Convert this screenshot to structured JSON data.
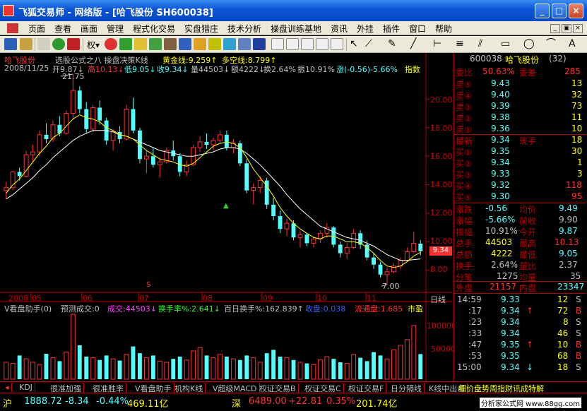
{
  "window": {
    "title": "飞狐交易师 - 网络版 - [哈飞股份 SH600038]",
    "min_glyph": "_",
    "max_glyph": "□",
    "close_glyph": "×"
  },
  "menu": {
    "items": [
      "页面",
      "查看",
      "画面",
      "管理",
      "程式化交易",
      "实盘猎庄",
      "技术分析",
      "操盘训练基地",
      "资讯",
      "外挂",
      "插件",
      "窗口",
      "帮助"
    ],
    "mdi_min": "_",
    "mdi_restore": "▣",
    "mdi_close": "×"
  },
  "toolbar": {
    "quan_label": "权",
    "quan_arrow": "▾"
  },
  "chart": {
    "header_stock": "哈飞股份",
    "header_formula": "选股公式之八 操盘决策K线",
    "header_gold": "黄金线:9.259↑",
    "header_duokong": "多空线:8.799↑",
    "price_line": {
      "date": "2008/11/25",
      "open": "开9.87↓",
      "high": "高10.13↓",
      "low": "低9.05↓",
      "close": "收9.34↓",
      "vol": "量44503↓",
      "amount": "额4222↓",
      "turnover": "换2.64%",
      "amplitude": "振10.91%",
      "change": "涨(-0.56)-5.66%",
      "indicator": "指数"
    },
    "high_label": "21.75",
    "low_label": "7.00",
    "current_price_label": "9.34",
    "s_marker": "S",
    "b_marker": "▲",
    "vol_header": {
      "name": "V看盘助手(0)",
      "forecast": "预测成交:0",
      "volume": "成交:44503↓",
      "turnover": "换手率%:2.641↓",
      "hundred_day": "百日换手%:162.839↑",
      "shou_pan": "收盘:0.038",
      "liutong": "流通盘:1.685",
      "market": "市盈"
    },
    "chart_data": {
      "type": "candlestick",
      "x_ticks": [
        "2008",
        "05",
        "06",
        "07",
        "08",
        "09",
        "10",
        "11"
      ],
      "right_label": "日线",
      "y_ticks": [
        "20.00",
        "18.00",
        "16.00",
        "14.00",
        "12.00",
        "10.00",
        "8.00"
      ],
      "vol_ticks": [
        "100000",
        "50000"
      ],
      "ylim": [
        7.0,
        21.75
      ],
      "vol_max": 120000,
      "candles": [
        [
          13.6,
          14.2,
          13.0,
          13.8
        ],
        [
          13.8,
          15.0,
          13.6,
          14.9
        ],
        [
          14.9,
          15.2,
          14.3,
          14.6
        ],
        [
          14.6,
          16.4,
          14.5,
          16.1
        ],
        [
          16.1,
          16.8,
          15.6,
          16.3
        ],
        [
          16.3,
          17.8,
          16.0,
          17.5
        ],
        [
          17.5,
          18.3,
          16.9,
          17.2
        ],
        [
          17.2,
          18.5,
          17.0,
          18.2
        ],
        [
          18.2,
          18.8,
          17.4,
          17.6
        ],
        [
          17.6,
          19.2,
          17.5,
          19.0
        ],
        [
          19.0,
          21.75,
          18.6,
          20.6
        ],
        [
          20.6,
          20.9,
          19.0,
          19.3
        ],
        [
          19.3,
          19.8,
          17.6,
          17.9
        ],
        [
          17.9,
          19.6,
          17.7,
          19.4
        ],
        [
          19.4,
          19.9,
          18.2,
          18.5
        ],
        [
          18.5,
          18.7,
          16.8,
          17.1
        ],
        [
          17.1,
          17.9,
          16.4,
          17.7
        ],
        [
          17.7,
          18.1,
          16.9,
          17.2
        ],
        [
          17.2,
          19.6,
          17.1,
          19.3
        ],
        [
          19.3,
          20.1,
          17.6,
          17.8
        ],
        [
          17.8,
          18.0,
          15.5,
          15.8
        ],
        [
          15.8,
          16.4,
          14.8,
          16.0
        ],
        [
          16.0,
          16.6,
          15.2,
          15.4
        ],
        [
          15.4,
          15.9,
          14.5,
          15.6
        ],
        [
          15.6,
          16.6,
          15.5,
          16.4
        ],
        [
          16.4,
          17.1,
          15.7,
          16.0
        ],
        [
          16.0,
          16.2,
          14.6,
          14.9
        ],
        [
          14.9,
          15.7,
          14.6,
          15.4
        ],
        [
          15.4,
          16.8,
          15.3,
          16.6
        ],
        [
          16.6,
          17.4,
          16.3,
          17.0
        ],
        [
          17.0,
          17.6,
          16.5,
          16.8
        ],
        [
          16.8,
          17.3,
          16.4,
          17.1
        ],
        [
          17.1,
          17.8,
          16.9,
          17.5
        ],
        [
          17.5,
          17.8,
          16.4,
          16.6
        ],
        [
          16.6,
          17.2,
          16.2,
          16.9
        ],
        [
          16.9,
          17.1,
          15.3,
          15.5
        ],
        [
          15.5,
          15.8,
          13.4,
          13.6
        ],
        [
          13.6,
          14.1,
          12.6,
          13.8
        ],
        [
          13.8,
          14.6,
          13.4,
          14.3
        ],
        [
          14.3,
          14.5,
          12.3,
          12.6
        ],
        [
          12.6,
          13.1,
          11.5,
          11.8
        ],
        [
          11.8,
          12.2,
          10.6,
          10.9
        ],
        [
          10.9,
          11.6,
          10.4,
          11.3
        ],
        [
          11.3,
          11.5,
          10.1,
          10.3
        ],
        [
          10.3,
          10.8,
          9.6,
          10.5
        ],
        [
          10.5,
          10.6,
          9.7,
          9.9
        ],
        [
          9.9,
          10.4,
          9.6,
          10.2
        ],
        [
          10.2,
          10.8,
          9.9,
          10.6
        ],
        [
          10.6,
          11.3,
          10.3,
          11.0
        ],
        [
          11.0,
          11.1,
          9.6,
          9.8
        ],
        [
          9.8,
          10.0,
          8.9,
          9.2
        ],
        [
          9.2,
          9.9,
          8.8,
          9.6
        ],
        [
          9.6,
          10.9,
          9.5,
          10.6
        ],
        [
          10.6,
          10.8,
          9.5,
          9.8
        ],
        [
          9.8,
          10.1,
          8.7,
          8.9
        ],
        [
          8.9,
          9.2,
          8.1,
          8.4
        ],
        [
          8.4,
          8.6,
          7.5,
          7.7
        ],
        [
          7.7,
          8.2,
          7.0,
          7.9
        ],
        [
          7.9,
          8.5,
          7.8,
          8.3
        ],
        [
          8.3,
          8.9,
          8.1,
          8.7
        ],
        [
          8.7,
          9.6,
          8.6,
          9.3
        ],
        [
          9.3,
          10.7,
          9.2,
          9.9
        ],
        [
          9.87,
          10.13,
          9.05,
          9.34
        ]
      ],
      "volumes": [
        30000,
        28000,
        42000,
        36000,
        30000,
        26000,
        45000,
        38000,
        32000,
        48000,
        115000,
        60000,
        40000,
        38000,
        34000,
        42000,
        36000,
        33000,
        44000,
        58000,
        46000,
        38000,
        42000,
        32000,
        30000,
        36000,
        40000,
        34000,
        50000,
        56000,
        42000,
        38000,
        44000,
        40000,
        36000,
        34000,
        42000,
        38000,
        30000,
        46000,
        52000,
        40000,
        38000,
        34000,
        30000,
        28000,
        26000,
        34000,
        40000,
        36000,
        30000,
        28000,
        44000,
        38000,
        32000,
        48000,
        42000,
        36000,
        52000,
        60000,
        70000,
        95000,
        44503
      ],
      "ma_short": [
        13.4,
        14.0,
        14.4,
        15.0,
        15.6,
        16.2,
        16.7,
        17.3,
        17.6,
        18.1,
        18.6,
        18.9,
        18.7,
        18.6,
        18.4,
        18.0,
        17.8,
        17.5,
        17.4,
        17.2,
        16.8,
        16.4,
        16.1,
        15.8,
        15.7,
        15.6,
        15.4,
        15.3,
        15.5,
        15.9,
        16.3,
        16.7,
        16.9,
        17.0,
        16.9,
        16.6,
        15.9,
        15.1,
        14.5,
        13.9,
        13.2,
        12.4,
        11.8,
        11.3,
        10.9,
        10.6,
        10.3,
        10.2,
        10.4,
        10.4,
        10.2,
        10.0,
        10.0,
        9.9,
        9.6,
        9.2,
        8.7,
        8.3,
        8.2,
        8.3,
        8.6,
        9.0,
        9.26
      ],
      "ma_long": [
        13.0,
        13.3,
        13.7,
        14.1,
        14.5,
        15.0,
        15.4,
        15.9,
        16.3,
        16.7,
        17.1,
        17.4,
        17.6,
        17.8,
        17.8,
        17.8,
        17.7,
        17.5,
        17.4,
        17.2,
        17.0,
        16.8,
        16.6,
        16.4,
        16.3,
        16.2,
        16.1,
        16.0,
        16.0,
        16.1,
        16.2,
        16.3,
        16.5,
        16.6,
        16.6,
        16.5,
        16.2,
        15.8,
        15.4,
        14.9,
        14.4,
        13.9,
        13.3,
        12.8,
        12.3,
        11.9,
        11.5,
        11.1,
        10.9,
        10.7,
        10.5,
        10.3,
        10.2,
        10.1,
        9.9,
        9.7,
        9.4,
        9.1,
        8.9,
        8.7,
        8.7,
        8.75,
        8.8
      ]
    }
  },
  "quote": {
    "code": "600038",
    "name": "哈飞股份",
    "count": "(32)",
    "weibi_label": "委比",
    "weibi_value": "50.63%",
    "weicha_label": "委差",
    "weicha_value": "285",
    "sells": [
      {
        "label": "卖⑤",
        "price": "9.43",
        "vol": "13"
      },
      {
        "label": "卖④",
        "price": "9.40",
        "vol": "32"
      },
      {
        "label": "卖③",
        "price": "9.39",
        "vol": "73"
      },
      {
        "label": "卖②",
        "price": "9.38",
        "vol": "11"
      },
      {
        "label": "卖①",
        "price": "9.36",
        "vol": "10"
      }
    ],
    "last_label": "最新",
    "last_value": "9.34",
    "hand_label": "现手",
    "hand_value": "18",
    "buys": [
      {
        "label": "买①",
        "price": "9.35",
        "vol": "30"
      },
      {
        "label": "买②",
        "price": "9.34",
        "vol": "1"
      },
      {
        "label": "买③",
        "price": "9.33",
        "vol": "3"
      },
      {
        "label": "买④",
        "price": "9.32",
        "vol": "118"
      },
      {
        "label": "买⑤",
        "price": "9.30",
        "vol": "95"
      }
    ],
    "stats": [
      {
        "l1": "涨跌",
        "v1": "-0.56",
        "l2": "均价",
        "v2": "9.49"
      },
      {
        "l1": "涨幅",
        "v1": "-5.66%",
        "l2": "前收",
        "v2": "9.90"
      },
      {
        "l1": "振幅",
        "v1": "10.91%",
        "l2": "今开",
        "v2": "9.87"
      },
      {
        "l1": "总手",
        "v1": "44503",
        "l2": "最高",
        "v2": "10.13"
      },
      {
        "l1": "总额",
        "v1": "4222",
        "l2": "最低",
        "v2": "9.05"
      },
      {
        "l1": "换手",
        "v1": "2.64%",
        "l2": "量比",
        "v2": "2.37"
      },
      {
        "l1": "分笔",
        "v1": "1275",
        "l2": "均量",
        "v2": "35"
      }
    ],
    "waipan_label": "外盘",
    "waipan_value": "21157",
    "neipan_label": "内盘",
    "neipan_value": "23347",
    "ticks": [
      {
        "time": "14:59",
        "price": "9.33",
        "arrow": "",
        "vol": "12",
        "side": "S"
      },
      {
        "time": ":17",
        "price": "9.34",
        "arrow": "↑",
        "vol": "72",
        "side": "B"
      },
      {
        "time": ":23",
        "price": "9.34",
        "arrow": "",
        "vol": "8",
        "side": "S"
      },
      {
        "time": ":33",
        "price": "9.34",
        "arrow": "",
        "vol": "46",
        "side": "S"
      },
      {
        "time": ":47",
        "price": "9.35",
        "arrow": "↑",
        "vol": "10",
        "side": "B"
      },
      {
        "time": ":53",
        "price": "9.35",
        "arrow": "",
        "vol": "68",
        "side": "B"
      },
      {
        "time": "15:00",
        "price": "9.34",
        "arrow": "↓",
        "vol": "18",
        "side": "S"
      }
    ]
  },
  "tabs": [
    "KDJ",
    "很准加强",
    "很准胜率",
    "V看盘助手",
    "机构K线",
    "V超级MACD",
    "权证交易B",
    "权证交易C",
    "权证交易F",
    "日分隔线",
    "K线中出击"
  ],
  "tab_scroll": "◂",
  "ad_text": "细价盘势周指财讯成特解",
  "status": {
    "sh_label": "沪",
    "sh_index": "1888.72",
    "sh_change": "-8.34",
    "sh_pct": "-0.44%",
    "sh_amount": "469.11亿",
    "sz_label": "深",
    "sz_index": "6489.00",
    "sz_change": "+22.81",
    "sz_pct": "0.35%",
    "sz_amount": "201.74亿",
    "site": "分析家公式网 www.88gg.com"
  },
  "colors": {
    "up": "#ff3232",
    "down": "#54ffff",
    "gold": "#ffff00",
    "label": "#c00000"
  }
}
